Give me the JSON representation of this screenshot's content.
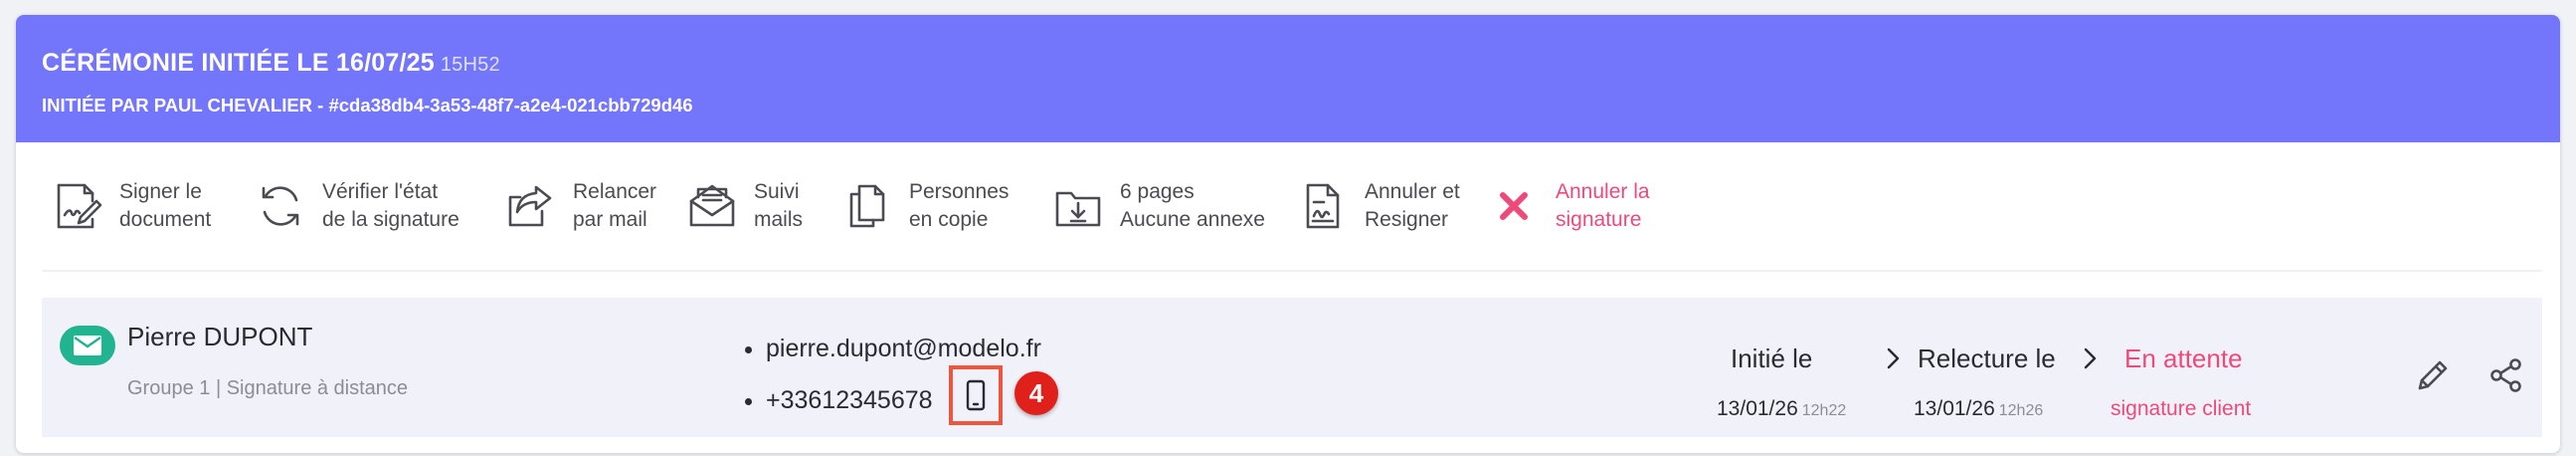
{
  "header": {
    "title": "CÉRÉMONIE INITIÉE LE 16/07/25",
    "time": "15H52",
    "initiated_by": "INITIÉE PAR PAUL CHEVALIER - #cda38db4-3a53-48f7-a2e4-021cbb729d46",
    "bg_color": "#7375fb"
  },
  "toolbar": [
    {
      "icon": "sign-document-icon",
      "line1": "Signer le",
      "line2": "document"
    },
    {
      "icon": "refresh-icon",
      "line1": "Vérifier l'état",
      "line2": "de la signature"
    },
    {
      "icon": "share-forward-icon",
      "line1": "Relancer",
      "line2": "par mail"
    },
    {
      "icon": "open-envelope-icon",
      "line1": "Suivi",
      "line2": "mails"
    },
    {
      "icon": "copy-icon",
      "line1": "Personnes",
      "line2": "en copie"
    },
    {
      "icon": "folder-download-icon",
      "line1": "6 pages",
      "line2": "Aucune annexe"
    },
    {
      "icon": "document-signature-icon",
      "line1": "Annuler et",
      "line2": "Resigner"
    },
    {
      "icon": "close-x-icon",
      "line1": "Annuler la",
      "line2": "signature",
      "color": "#ee4a79"
    }
  ],
  "signer": {
    "name": "Pierre DUPONT",
    "group": "Groupe 1 | Signature à distance",
    "email": "pierre.dupont@modelo.fr",
    "phone": "+33612345678",
    "marker": "4",
    "steps": [
      {
        "label": "Initié le",
        "date": "13/01/26",
        "time": "12h22"
      },
      {
        "label": "Relecture le",
        "date": "13/01/26",
        "time": "12h26"
      },
      {
        "label": "En attente",
        "sub": "signature client"
      }
    ],
    "badge_color": "#22b391",
    "pending_color": "#ee4a79"
  }
}
